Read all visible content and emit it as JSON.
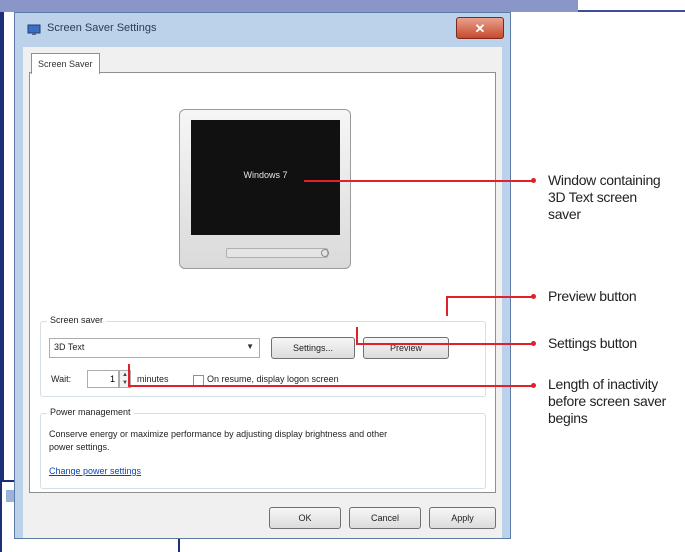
{
  "window": {
    "title": "Screen Saver Settings",
    "close_glyph": "✕"
  },
  "tab": {
    "label": "Screen Saver"
  },
  "preview": {
    "screen_text": "Windows 7"
  },
  "screen_saver_group": {
    "legend": "Screen saver",
    "selected_saver": "3D Text",
    "settings_label": "Settings...",
    "preview_label": "Preview",
    "wait_label": "Wait:",
    "wait_value": "1",
    "minutes_label": "minutes",
    "resume_checkbox_label": "On resume, display logon screen",
    "resume_checked": false
  },
  "power_group": {
    "legend": "Power management",
    "description": "Conserve energy or maximize performance by adjusting display brightness and other power settings.",
    "link_label": "Change power settings"
  },
  "footer": {
    "ok_label": "OK",
    "cancel_label": "Cancel",
    "apply_label": "Apply"
  },
  "callouts": {
    "window_containing": "Window containing 3D Text screen saver",
    "preview_button": "Preview button",
    "settings_button": "Settings button",
    "length_of_inactivity": "Length of inactivity before screen saver begins"
  },
  "colors": {
    "callout_red": "#e0202a",
    "link_blue": "#0a47a8",
    "window_frame": "#bcd2ea"
  }
}
